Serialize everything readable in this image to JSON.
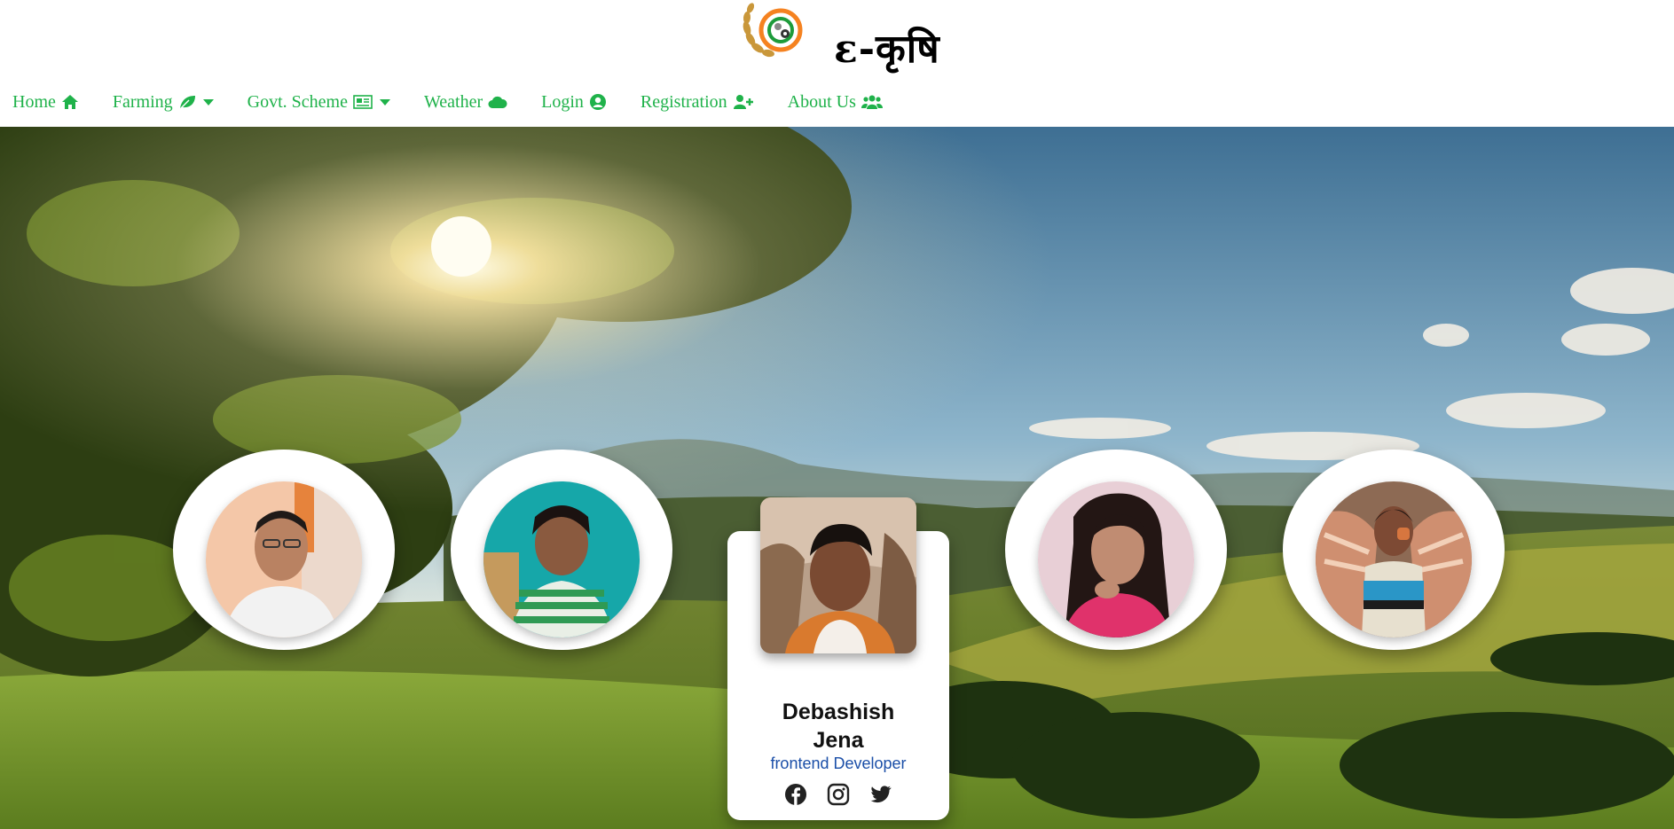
{
  "brand": {
    "name": "ε-कृषि"
  },
  "nav": {
    "items": [
      {
        "label": "Home",
        "icon": "home-icon",
        "dropdown": false
      },
      {
        "label": "Farming",
        "icon": "leaf-icon",
        "dropdown": true
      },
      {
        "label": "Govt. Scheme",
        "icon": "newspaper-icon",
        "dropdown": true
      },
      {
        "label": "Weather",
        "icon": "cloud-icon",
        "dropdown": false
      },
      {
        "label": "Login",
        "icon": "user-circle-icon",
        "dropdown": false
      },
      {
        "label": "Registration",
        "icon": "user-plus-icon",
        "dropdown": false
      },
      {
        "label": "About Us",
        "icon": "users-icon",
        "dropdown": false
      }
    ]
  },
  "team": {
    "featured": {
      "name": "Debashish Jena",
      "role": "frontend Developer",
      "socials": [
        "facebook-icon",
        "instagram-icon",
        "twitter-icon"
      ]
    },
    "members": [
      {
        "avatar": "member-photo-1"
      },
      {
        "avatar": "member-photo-2"
      },
      {
        "avatar": "member-photo-3"
      },
      {
        "avatar": "member-photo-4"
      }
    ]
  },
  "colors": {
    "nav": "#1fb24a",
    "role": "#1b4fa8",
    "card": "#ffffff"
  }
}
